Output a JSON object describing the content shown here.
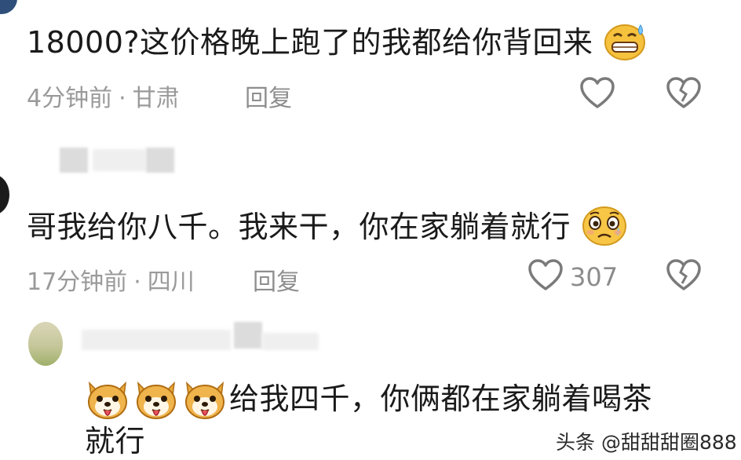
{
  "comments": [
    {
      "text": "18000?这价格晚上跑了的我都给你背回来",
      "time": "4分钟前",
      "separator": "·",
      "location": "甘肃",
      "reply_label": "回复",
      "emoji": "grinning-sweat-emoji"
    },
    {
      "text": "哥我给你八千。我来干，你在家躺着就行",
      "time": "17分钟前",
      "separator": "·",
      "location": "四川",
      "reply_label": "回复",
      "like_count": "307",
      "emoji": "pleading-tear-emoji"
    },
    {
      "text_line1": "给我四千，你俩都在家躺着喝茶",
      "text_line2": "就行",
      "emoji": "dog-tongue-emoji"
    }
  ],
  "watermark": {
    "platform": "头条",
    "handle": "@甜甜甜圈888"
  },
  "colors": {
    "text": "#1a1a1a",
    "meta": "#9a9a9a",
    "icon_stroke": "#7a7a7a"
  }
}
